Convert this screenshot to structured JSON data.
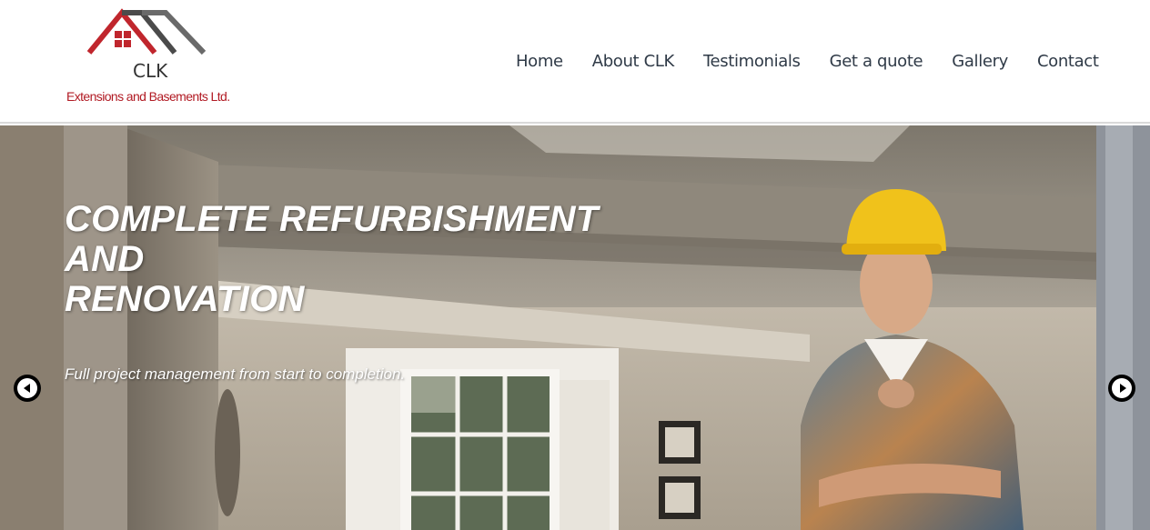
{
  "brand": {
    "abbr": "CLK",
    "tagline": "Extensions and Basements Ltd.",
    "roof_red": "#c0262d",
    "roof_grey": "#5a5a5a"
  },
  "nav": {
    "items": [
      "Home",
      "About CLK",
      "Testimonials",
      "Get a quote",
      "Gallery",
      "Contact"
    ]
  },
  "hero": {
    "title_lines": [
      "COMPLETE REFURBISHMENT",
      "AND",
      "RENOVATION"
    ],
    "subtitle": "Full project management from start to completion.",
    "prev_icon": "chevron-left-icon",
    "next_icon": "chevron-right-icon"
  }
}
